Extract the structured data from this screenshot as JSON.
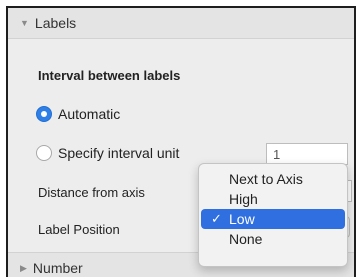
{
  "labels_section": {
    "title": "Labels",
    "expanded": true,
    "interval_heading": "Interval between labels",
    "automatic_label": "Automatic",
    "automatic_selected": true,
    "specify_label": "Specify interval unit",
    "specify_selected": false,
    "interval_value": "1",
    "distance_label": "Distance from axis",
    "position_label": "Label Position"
  },
  "label_position_menu": {
    "options": [
      "Next to Axis",
      "High",
      "Low",
      "None"
    ],
    "selected": "Low",
    "check_glyph": "✓"
  },
  "number_section": {
    "title": "Number",
    "expanded": false
  },
  "icons": {
    "expanded": "▼",
    "collapsed": "▶"
  },
  "colors": {
    "accent": "#2f6fe0",
    "panel": "#ededed"
  }
}
